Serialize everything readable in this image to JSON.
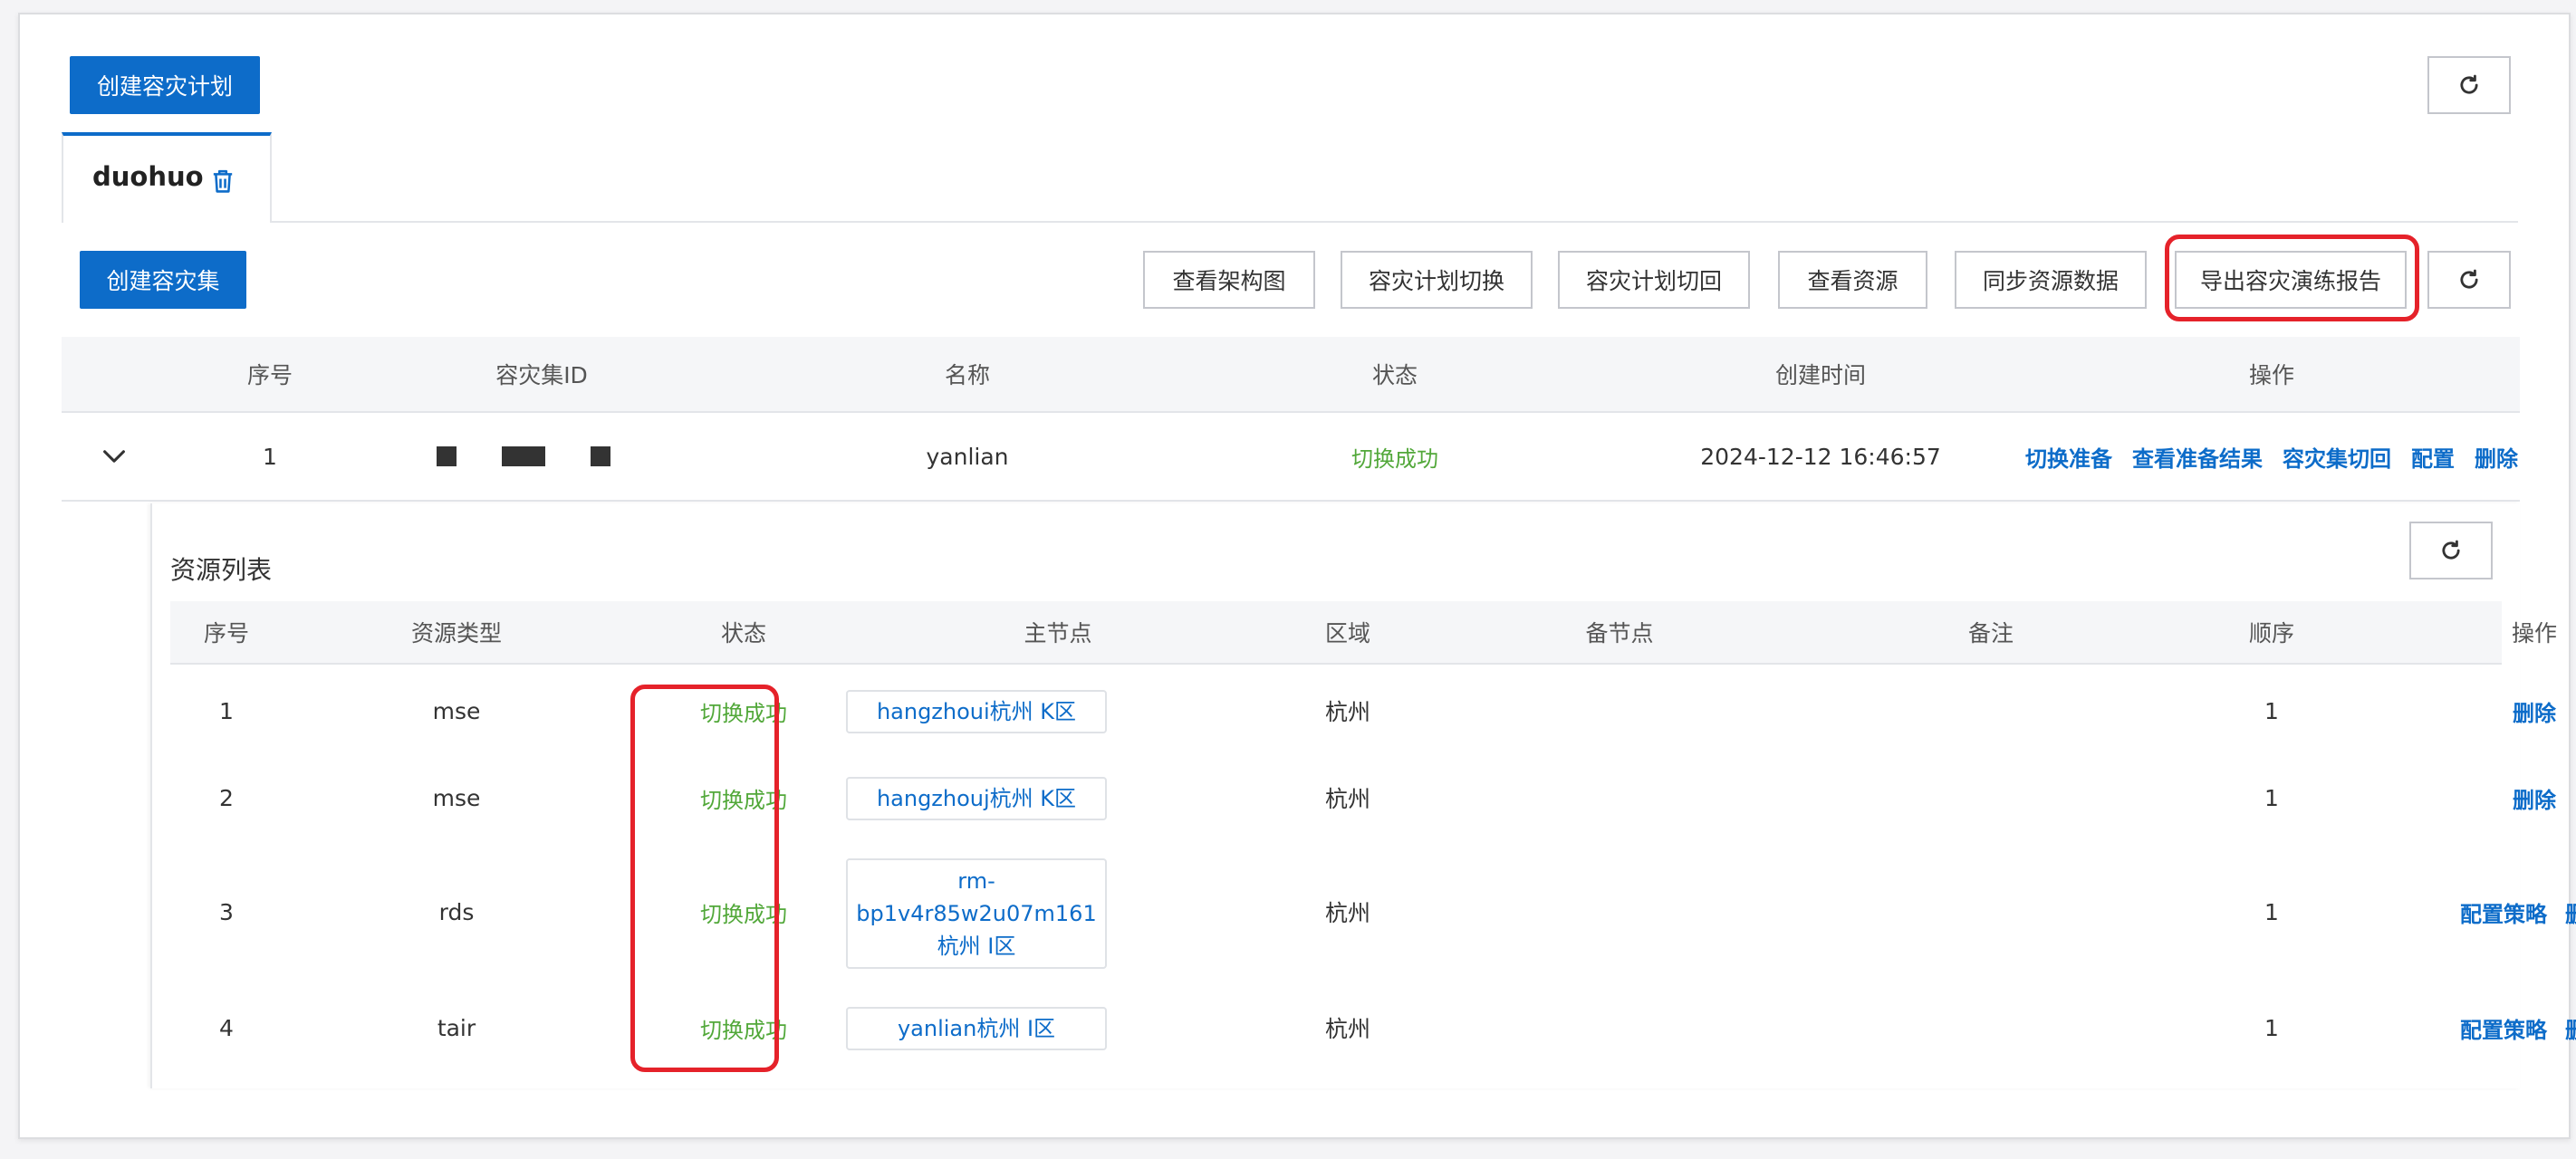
{
  "top": {
    "create_plan_label": "创建容灾计划"
  },
  "tab": {
    "name": "duohuo"
  },
  "toolbar": {
    "create_set_label": "创建容灾集",
    "buttons": [
      "查看架构图",
      "容灾计划切换",
      "容灾计划切回",
      "查看资源",
      "同步资源数据",
      "导出容灾演练报告"
    ]
  },
  "main_table": {
    "headers": [
      "序号",
      "容灾集ID",
      "名称",
      "状态",
      "创建时间",
      "操作"
    ],
    "row": {
      "index": "1",
      "name": "yanlian",
      "status": "切换成功",
      "created": "2024-12-12 16:46:57",
      "actions": [
        "切换准备",
        "查看准备结果",
        "容灾集切回",
        "配置",
        "删除"
      ]
    }
  },
  "resources": {
    "title": "资源列表",
    "headers": [
      "序号",
      "资源类型",
      "状态",
      "主节点",
      "区域",
      "备节点",
      "备注",
      "顺序",
      "操作"
    ],
    "rows": [
      {
        "index": "1",
        "type": "mse",
        "status": "切换成功",
        "node": "hangzhoui杭州 K区",
        "region": "杭州",
        "order": "1",
        "actions": [
          "删除"
        ]
      },
      {
        "index": "2",
        "type": "mse",
        "status": "切换成功",
        "node": "hangzhouj杭州 K区",
        "region": "杭州",
        "order": "1",
        "actions": [
          "删除"
        ]
      },
      {
        "index": "3",
        "type": "rds",
        "status": "切换成功",
        "node_lines": [
          "rm-",
          "bp1v4r85w2u07m161",
          "杭州 I区"
        ],
        "region": "杭州",
        "order": "1",
        "actions": [
          "配置策略",
          "删除"
        ]
      },
      {
        "index": "4",
        "type": "tair",
        "status": "切换成功",
        "node": "yanlian杭州 I区",
        "region": "杭州",
        "order": "1",
        "actions": [
          "配置策略",
          "删除"
        ]
      }
    ]
  },
  "colors": {
    "primary": "#0d6cc9",
    "success": "#52a83a",
    "highlight": "#e5222a"
  }
}
